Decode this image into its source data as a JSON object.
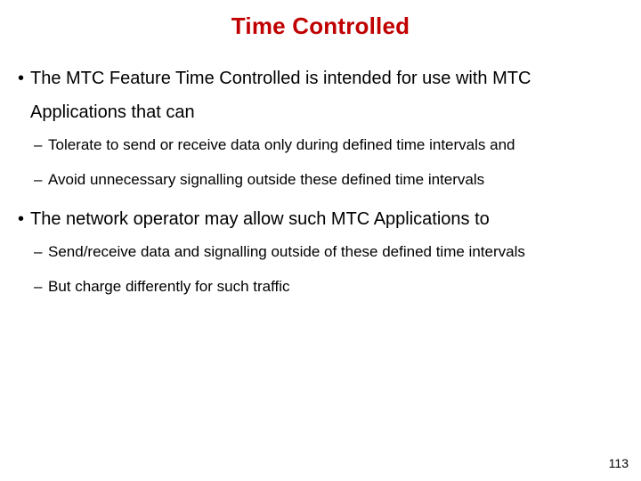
{
  "title": "Time Controlled",
  "bullets": [
    {
      "text": "The MTC Feature Time Controlled is intended for use with MTC Applications that can",
      "sub": [
        "Tolerate to send or receive data only during defined time intervals and",
        "Avoid unnecessary signalling outside these defined time intervals"
      ]
    },
    {
      "text": "The network operator may allow such MTC Applications to",
      "sub": [
        "Send/receive data and signalling outside of these defined time intervals",
        "But charge differently for such traffic"
      ]
    }
  ],
  "glyphs": {
    "bullet": "•",
    "dash": "–"
  },
  "page_number": "113"
}
